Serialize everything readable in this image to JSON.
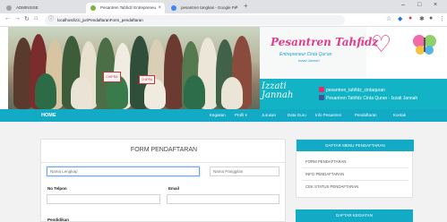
{
  "browser": {
    "tabs": [
      {
        "label": "ADMINISSE",
        "active": false
      },
      {
        "label": "Pesantren Tahfidz Entrepreneu",
        "active": true
      },
      {
        "label": "pesantren tangkas - Google Pe",
        "active": false
      }
    ],
    "url": "localhost/izzi_jur/PendaftaranForm_pendaftaran"
  },
  "banner": {
    "brand_title": "Pesantren Tahfidz",
    "tagline": "Entrepreneur Cinta Qur'an",
    "tagline_sub": "Izzati Jannah",
    "izzati_line1": "Izzati",
    "izzati_line2": "Jannah",
    "instagram": "pesantren_tahfidz_cintaquran",
    "facebook": "Pesantren Tahfidz Cinta Quran - Izzati Jannah",
    "sign_text": "CHIPRA"
  },
  "nav": {
    "home": "HOME",
    "items": [
      "Kegiatan",
      "Profil ▾",
      "Jurusan",
      "Data Guru",
      "Info Pesantren",
      "Pendaftaran",
      "Kontak"
    ]
  },
  "form": {
    "title": "FORM PENDAFTARAN",
    "nama_lengkap_placeholder": "Nama Lengkap",
    "nama_panggilan_placeholder": "Nama Panggilan",
    "no_telpon_label": "No Telpon",
    "email_label": "Email",
    "pendidikan_label": "Pendidikan"
  },
  "sidebar": {
    "menu_title": "DAFTAR MENU PENDAFTARAN",
    "links": [
      "FORM PENDAFTARAN",
      "INFO PENDAFTARAN",
      "CEK STATUS PENDAFTARAN"
    ],
    "kegiatan_title": "DAFTAR KEGIATAN"
  },
  "colors": {
    "accent": "#13aac6",
    "brand_pink": "#e23b8a"
  }
}
